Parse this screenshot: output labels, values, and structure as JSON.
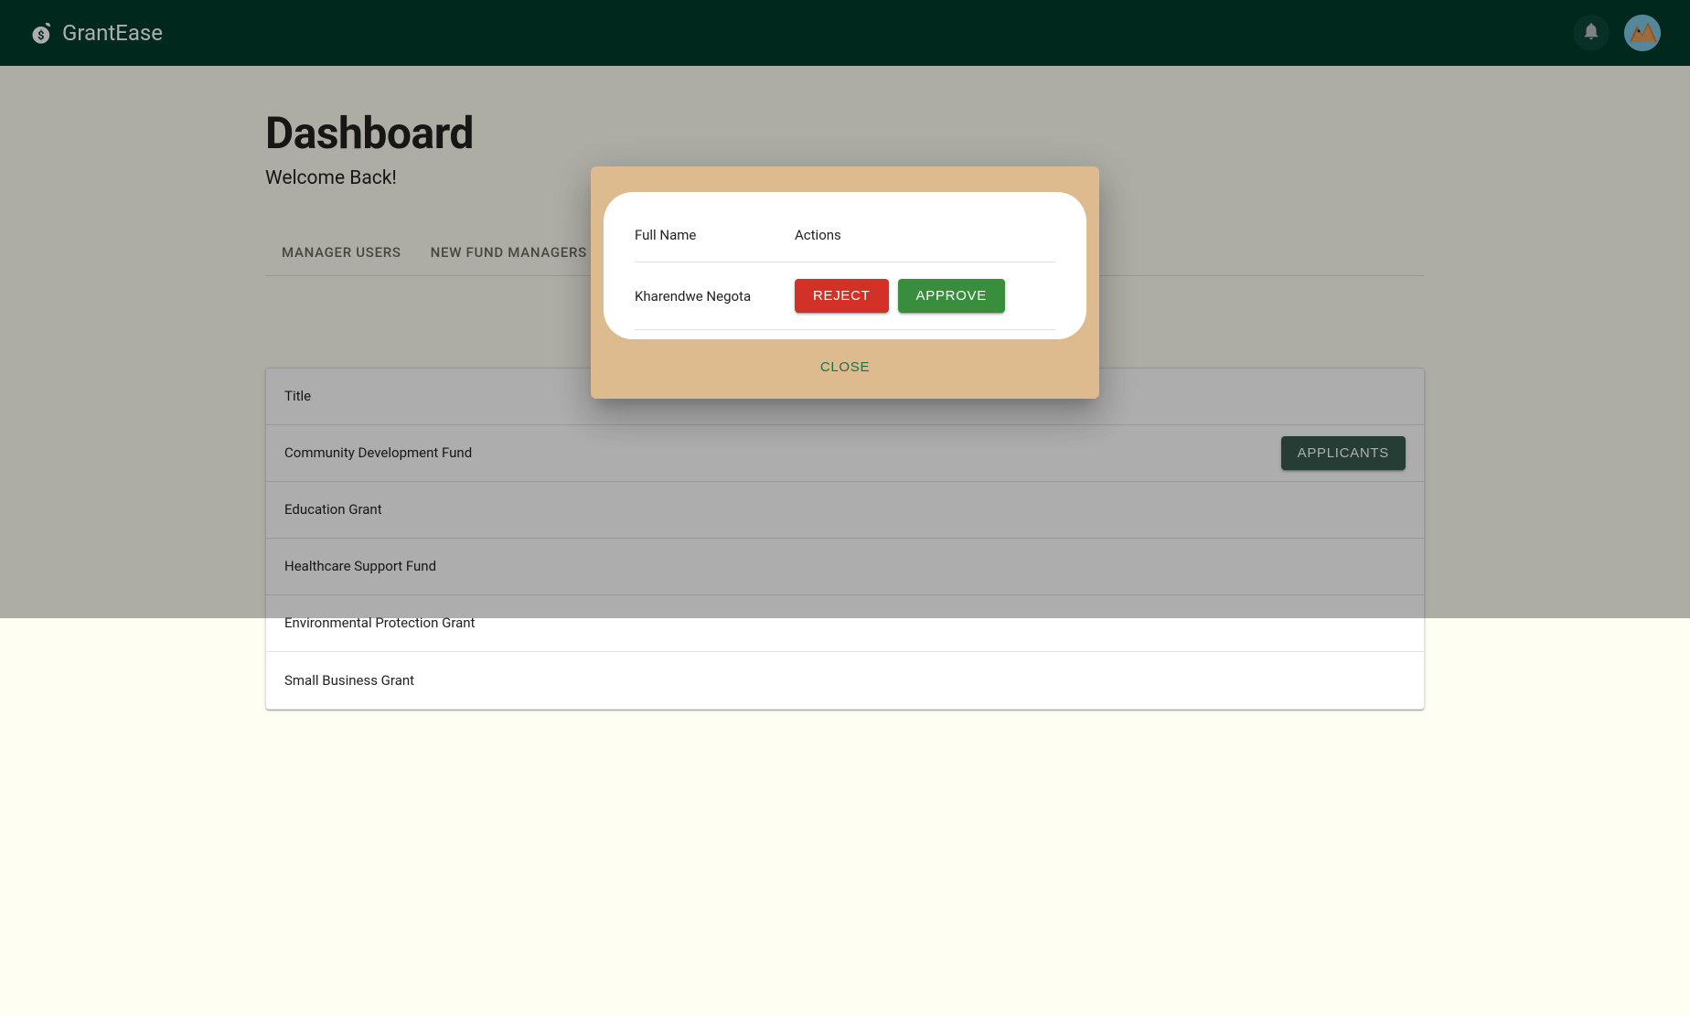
{
  "header": {
    "brand": "GrantEase"
  },
  "page": {
    "title": "Dashboard",
    "welcome": "Welcome Back!"
  },
  "tabs": [
    {
      "label": "MANAGER USERS"
    },
    {
      "label": "NEW FUND MANAGERS"
    }
  ],
  "table": {
    "headers": {
      "title": "Title"
    },
    "rows": [
      {
        "title": "Community Development Fund",
        "has_applicants_button": true
      },
      {
        "title": "Education Grant",
        "has_applicants_button": false
      },
      {
        "title": "Healthcare Support Fund",
        "has_applicants_button": false
      },
      {
        "title": "Environmental Protection Grant",
        "has_applicants_button": false
      },
      {
        "title": "Small Business Grant",
        "has_applicants_button": false
      }
    ],
    "applicants_label": "APPLICANTS"
  },
  "modal": {
    "headers": {
      "full_name": "Full Name",
      "actions": "Actions"
    },
    "rows": [
      {
        "full_name": "Kharendwe Negota"
      }
    ],
    "reject_label": "REJECT",
    "approve_label": "APPROVE",
    "close_label": "CLOSE"
  }
}
